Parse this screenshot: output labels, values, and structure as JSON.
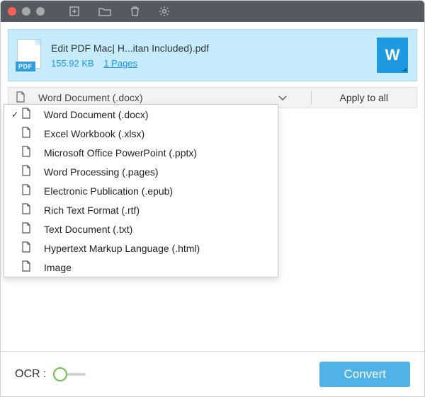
{
  "file": {
    "name": "Edit PDF Mac| H...itan Included).pdf",
    "size": "155.92 KB",
    "pages": "1 Pages",
    "out_icon": "W",
    "pdf_badge": "PDF"
  },
  "format_bar": {
    "selected": "Word Document (.docx)",
    "apply_all": "Apply to all"
  },
  "dropdown": [
    {
      "label": "Word Document (.docx)",
      "checked": true
    },
    {
      "label": "Excel Workbook (.xlsx)",
      "checked": false
    },
    {
      "label": "Microsoft Office PowerPoint (.pptx)",
      "checked": false
    },
    {
      "label": "Word Processing (.pages)",
      "checked": false
    },
    {
      "label": "Electronic Publication (.epub)",
      "checked": false
    },
    {
      "label": "Rich Text Format (.rtf)",
      "checked": false
    },
    {
      "label": "Text Document (.txt)",
      "checked": false
    },
    {
      "label": "Hypertext Markup Language (.html)",
      "checked": false
    },
    {
      "label": "Image",
      "checked": false
    }
  ],
  "footer": {
    "ocr_label": "OCR :",
    "convert": "Convert"
  }
}
